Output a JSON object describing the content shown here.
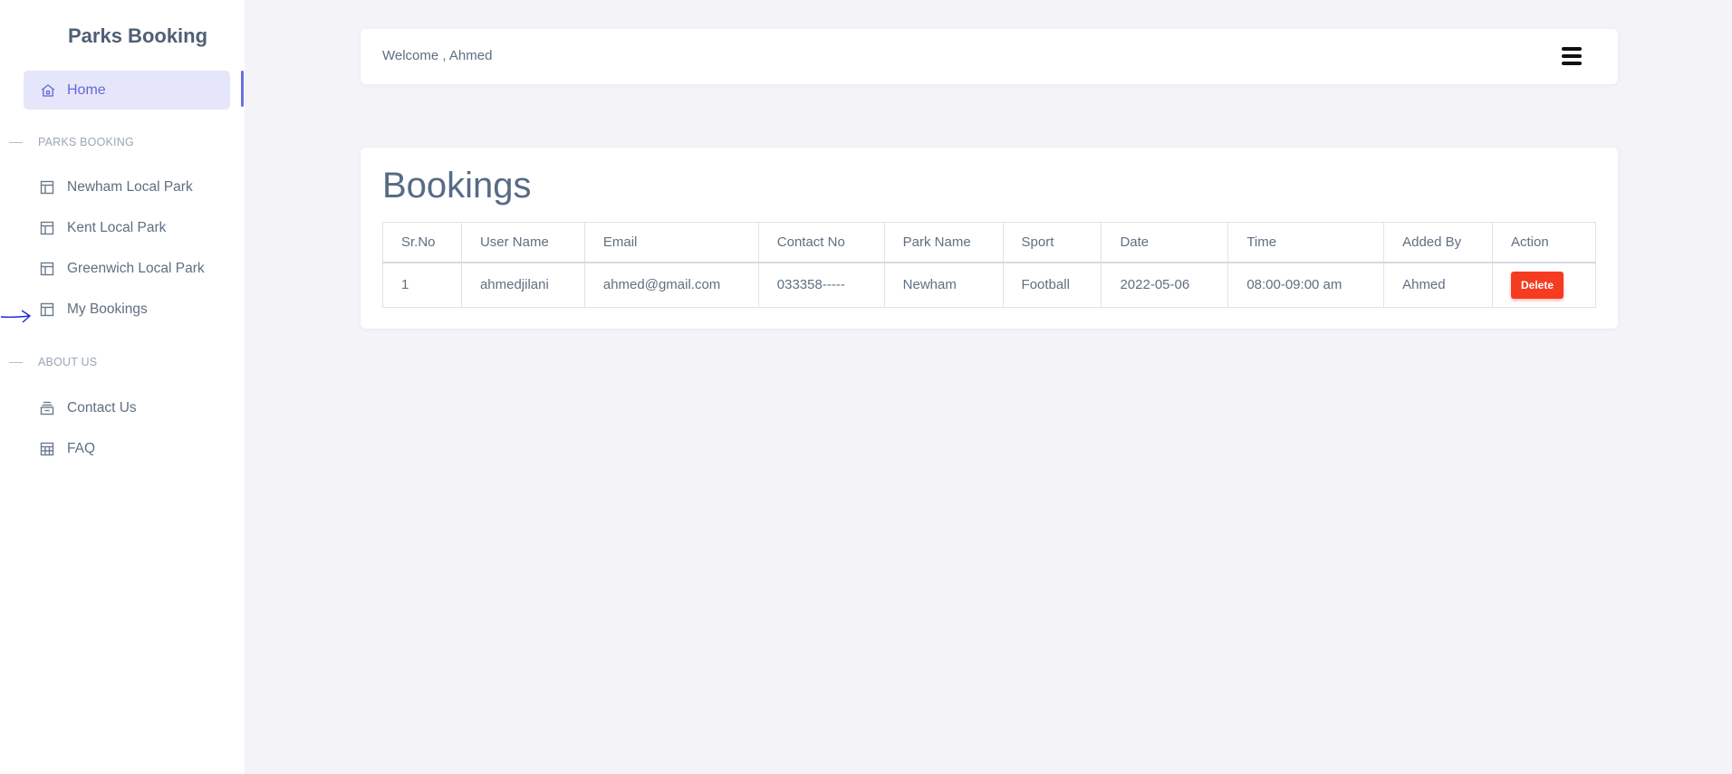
{
  "sidebar": {
    "brand": "Parks Booking",
    "home_label": "Home",
    "section_parks": "PARKS BOOKING",
    "parks_items": [
      {
        "label": "Newham Local Park"
      },
      {
        "label": "Kent Local Park"
      },
      {
        "label": "Greenwich Local Park"
      },
      {
        "label": "My Bookings"
      }
    ],
    "section_about": "ABOUT US",
    "about_items": [
      {
        "label": "Contact Us"
      },
      {
        "label": "FAQ"
      }
    ]
  },
  "header": {
    "welcome": "Welcome , Ahmed"
  },
  "bookings": {
    "title": "Bookings",
    "columns": [
      "Sr.No",
      "User Name",
      "Email",
      "Contact No",
      "Park Name",
      "Sport",
      "Date",
      "Time",
      "Added By",
      "Action"
    ],
    "rows": [
      {
        "sr_no": "1",
        "user_name": "ahmedjilani",
        "email": "ahmed@gmail.com",
        "contact_no": "033358-----",
        "park_name": "Newham",
        "sport": "Football",
        "date": "2022-05-06",
        "time": "08:00-09:00 am",
        "added_by": "Ahmed",
        "action_label": "Delete"
      }
    ]
  },
  "colors": {
    "accent": "#6268d6",
    "delete": "#f53b20",
    "background": "#f3f3f8"
  },
  "icons": {
    "home": "home-icon",
    "park": "layout-icon",
    "contact": "inbox-stack-icon",
    "faq": "grid-table-icon",
    "menu": "hamburger-icon"
  }
}
